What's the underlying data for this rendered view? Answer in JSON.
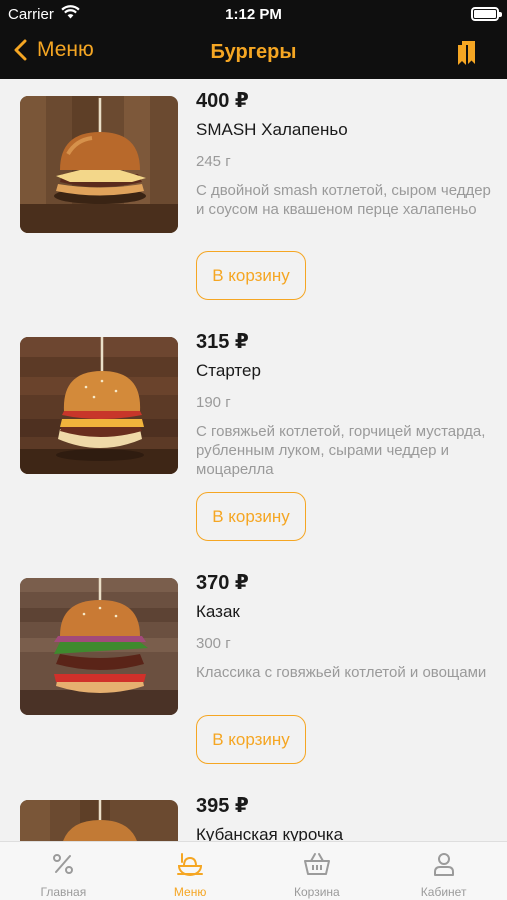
{
  "status": {
    "carrier": "Carrier",
    "time": "1:12 PM"
  },
  "nav": {
    "back_label": "Меню",
    "title": "Бургеры",
    "bookmark_icon": "bookmark-icon"
  },
  "colors": {
    "accent": "#f5a623",
    "header_bg": "#0f0f0f",
    "background": "#f2f2f2"
  },
  "products": [
    {
      "price": "400 ₽",
      "name": "SMASH Халапеньо",
      "weight": "245 г",
      "description": "С двойной smash котлетой, сыром чеддер и соусом на квашеном перце халапеньо",
      "button": "В корзину"
    },
    {
      "price": "315 ₽",
      "name": "Стартер",
      "weight": "190 г",
      "description": "С говяжьей котлетой, горчицей мустарда, рубленным луком, сырами чеддер и моцарелла",
      "button": "В корзину"
    },
    {
      "price": "370 ₽",
      "name": "Казак",
      "weight": "300 г",
      "description": "Классика с говяжьей котлетой и овощами",
      "button": "В корзину"
    },
    {
      "price": "395 ₽",
      "name": "Кубанская курочка"
    }
  ],
  "tabbar": [
    {
      "label": "Главная",
      "icon": "percent-icon"
    },
    {
      "label": "Меню",
      "icon": "menu-dish-icon"
    },
    {
      "label": "Корзина",
      "icon": "basket-icon"
    },
    {
      "label": "Кабинет",
      "icon": "profile-icon"
    }
  ],
  "active_tab": "Меню"
}
